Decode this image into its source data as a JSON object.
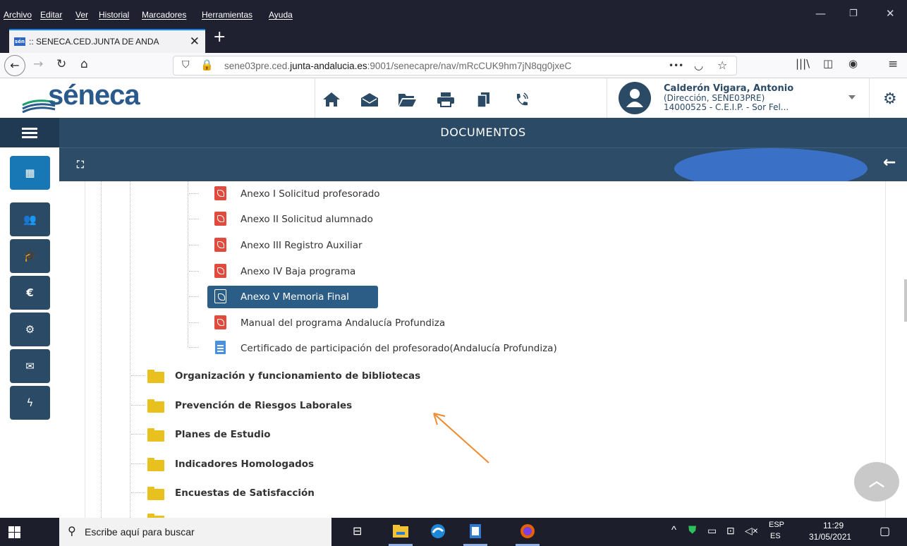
{
  "browser": {
    "menu": [
      "Archivo",
      "Editar",
      "Ver",
      "Historial",
      "Marcadores",
      "Herramientas",
      "Ayuda"
    ],
    "tab_title": ":: SENECA.CED.JUNTA DE ANDA",
    "tab_favicon": "sén",
    "url_prefix": "sene03pre.ced.",
    "url_domain": "junta-andalucia.es",
    "url_rest": ":9001/senecapre/nav/mRcCUK9hm7jN8qg0jxeC",
    "url_dots": "•••"
  },
  "app": {
    "logo": "séneca",
    "user_name": "Calderón Vigara, Antonio",
    "user_role": "(Dirección, SENE03PRE)",
    "user_center": "14000525 - C.E.I.P. - Sor Fel...",
    "section_title": "DOCUMENTOS"
  },
  "tree": {
    "documents": [
      {
        "label": "Anexo I Solicitud profesorado",
        "icon": "pdf-icon"
      },
      {
        "label": "Anexo II Solicitud alumnado",
        "icon": "pdf-icon"
      },
      {
        "label": "Anexo III Registro Auxiliar",
        "icon": "pdf-icon"
      },
      {
        "label": "Anexo IV Baja programa",
        "icon": "pdf-icon"
      },
      {
        "label": "Anexo V Memoria Final",
        "icon": "pdf-icon",
        "selected": true
      },
      {
        "label": "Manual del programa Andalucía Profundiza",
        "icon": "pdf-icon"
      },
      {
        "label": "Certificado de participación del profesorado(Andalucía Profundiza)",
        "icon": "document-icon"
      }
    ],
    "folders": [
      "Organización y funcionamiento de bibliotecas",
      "Prevención de Riesgos Laborales",
      "Planes de Estudio",
      "Indicadores Homologados",
      "Encuestas de Satisfacción"
    ]
  },
  "taskbar": {
    "search_placeholder": "Escribe aquí para buscar",
    "lang_top": "ESP",
    "lang_bottom": "ES",
    "time": "11:29",
    "date": "31/05/2021"
  },
  "colors": {
    "brand_dark": "#2b4a66",
    "selected": "#2c5d86",
    "pdf": "#e14b3d",
    "folder": "#e8c11f",
    "annotation_arrow": "#f08a2c"
  }
}
